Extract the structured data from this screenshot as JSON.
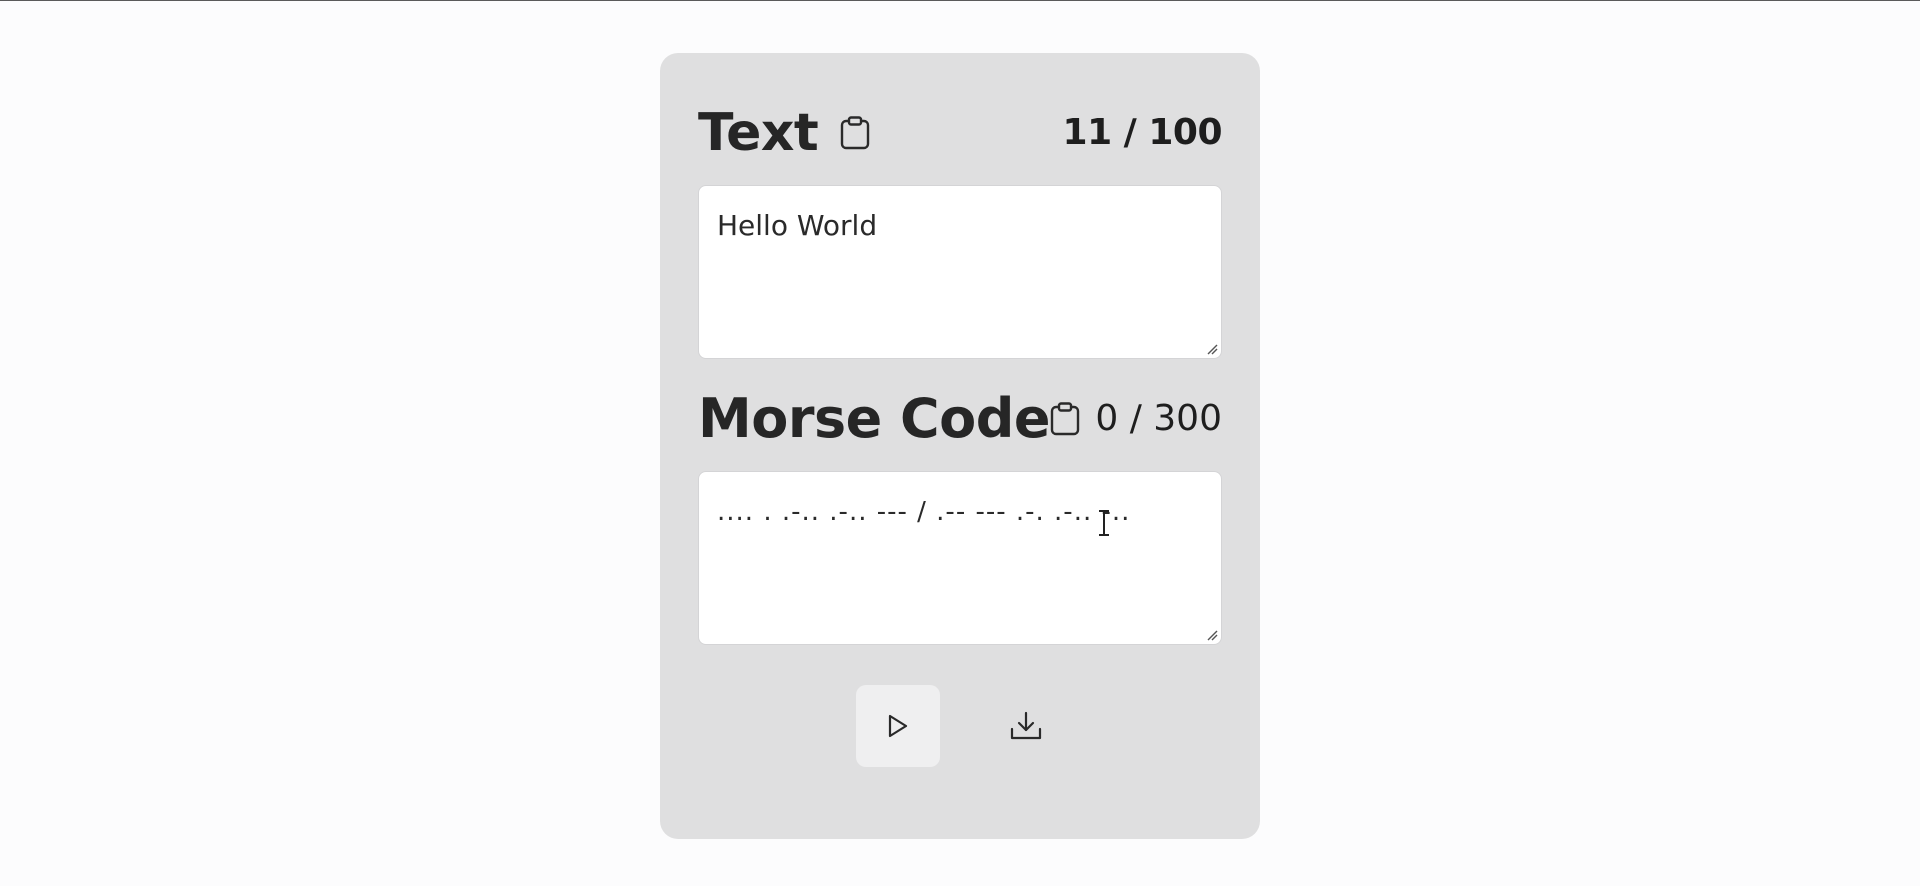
{
  "text_section": {
    "title": "Text",
    "counter": "11 / 100",
    "value": "Hello World",
    "copy_icon": "clipboard-icon"
  },
  "morse_section": {
    "title": "Morse Code",
    "counter": "0 / 300",
    "value": ".... . .-.. .-.. --- / .-- --- .-. .-.. -..",
    "copy_icon": "clipboard-icon"
  },
  "actions": {
    "play_icon": "play-icon",
    "download_icon": "download-icon"
  },
  "colors": {
    "page_background": "#fcfcfd",
    "card_background": "#dfdfe0",
    "input_background": "#ffffff",
    "play_button_background": "#efeff0",
    "text": "#262626"
  }
}
